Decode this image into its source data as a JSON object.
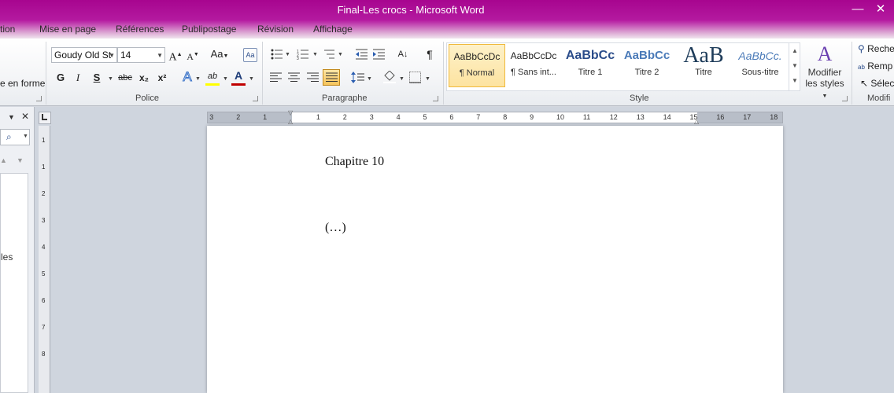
{
  "window": {
    "title": "Final-Les crocs  -  Microsoft Word",
    "minimize": "—",
    "close": "✕"
  },
  "tabs": [
    "tion",
    "Mise en page",
    "Références",
    "Publipostage",
    "Révision",
    "Affichage"
  ],
  "clipboard_partial": {
    "label": "e en forme"
  },
  "font": {
    "name": "Goudy Old St",
    "size": "14",
    "grow": "A",
    "shrink": "A",
    "case": "Aa",
    "bold": "G",
    "italic": "I",
    "underline": "S",
    "strike": "abc",
    "subscript": "x₂",
    "superscript": "x²",
    "effects": "A",
    "highlight": "ab",
    "color": "A",
    "group_label": "Police"
  },
  "paragraph": {
    "group_label": "Paragraphe",
    "pilcrow": "¶",
    "sort": "A↓"
  },
  "styles": {
    "group_label": "Style",
    "items": [
      {
        "preview": "AaBbCcDc",
        "name": "¶ Normal"
      },
      {
        "preview": "AaBbCcDc",
        "name": "¶ Sans int..."
      },
      {
        "preview": "AaBbCc",
        "name": "Titre 1"
      },
      {
        "preview": "AaBbCc",
        "name": "Titre 2"
      },
      {
        "preview": "AaB",
        "name": "Titre"
      },
      {
        "preview": "AaBbCc.",
        "name": "Sous-titre"
      }
    ],
    "change_line1": "Modifier",
    "change_line2": "les styles"
  },
  "editing": {
    "group_label": "Modifi",
    "find": "Reche",
    "replace": "Remp",
    "select": "Sélec"
  },
  "navpane": {
    "close": "✕",
    "partial_text": "les"
  },
  "ruler": {
    "numbers": [
      "3",
      "2",
      "1",
      "1",
      "2",
      "3",
      "4",
      "5",
      "6",
      "7",
      "8",
      "9",
      "10",
      "11",
      "12",
      "13",
      "14",
      "15",
      "16",
      "17",
      "18"
    ]
  },
  "vruler": {
    "numbers": [
      "1",
      "1",
      "2",
      "3",
      "4",
      "5",
      "6",
      "7",
      "8"
    ]
  },
  "document": {
    "heading": "Chapitre 10",
    "body": "(…)"
  },
  "colors": {
    "title_bar": "#a7058f",
    "accent_selected": "#f0b93b",
    "font_color_line": "#c00000",
    "highlight_line": "#ffff00"
  }
}
